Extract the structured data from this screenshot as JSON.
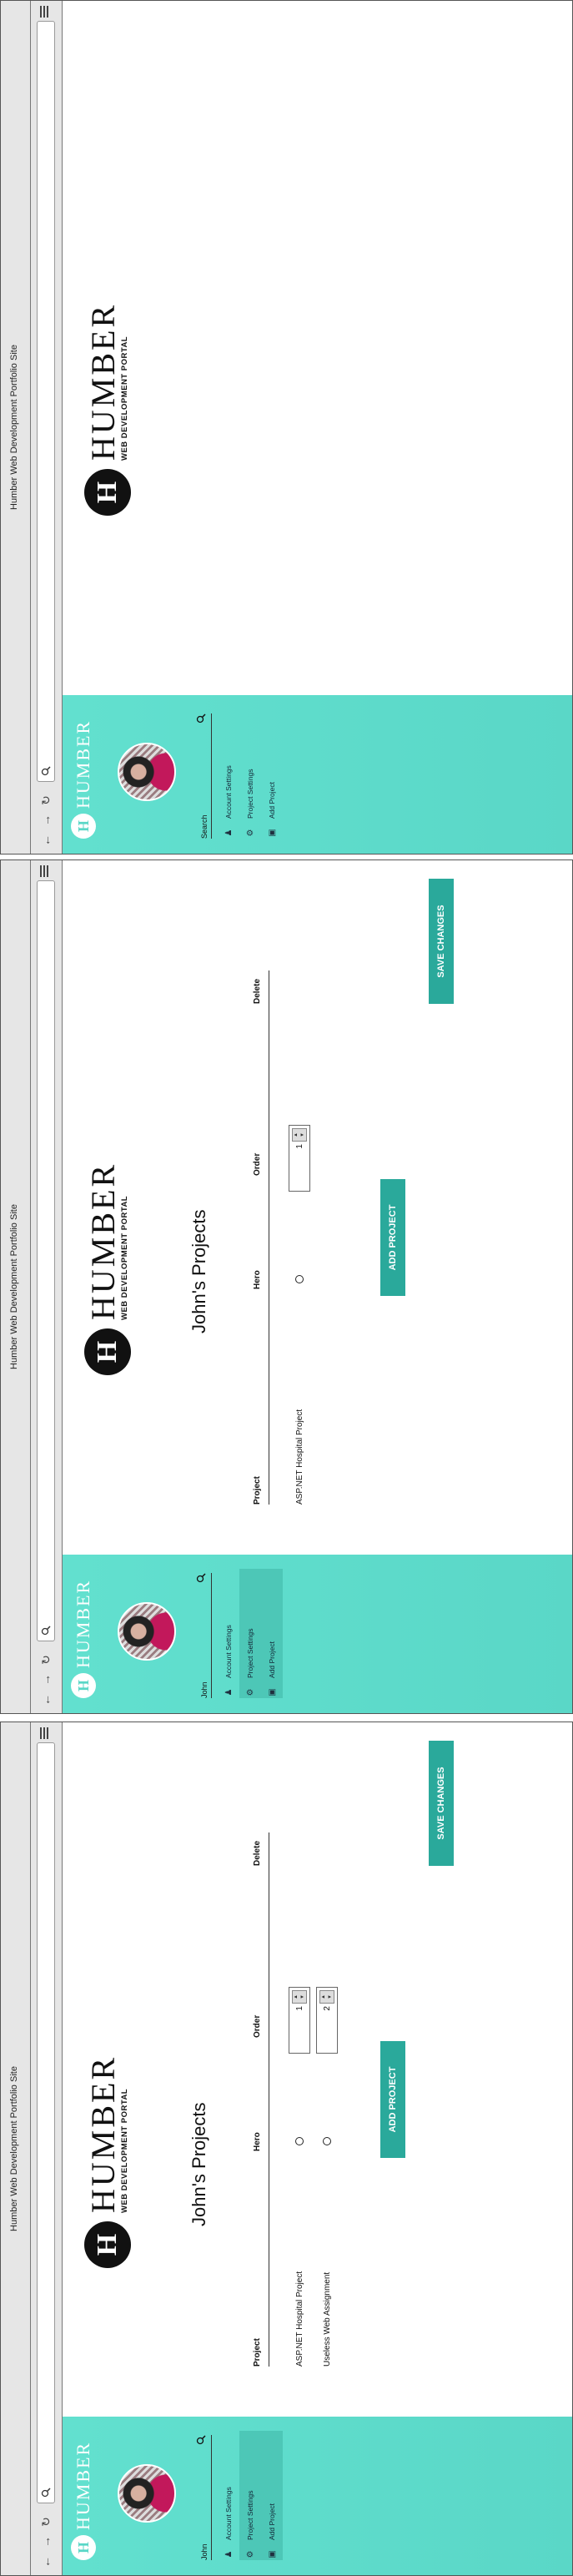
{
  "browser": {
    "window_title": "Humber Web Development Portfolio Site",
    "icons": [
      "back-arrow-icon",
      "forward-arrow-icon",
      "refresh-icon",
      "search-icon",
      "hamburger-menu-icon"
    ]
  },
  "sidebar": {
    "brand": "HUMBER",
    "brand_mark": "H",
    "search_label": "Search",
    "user_name": "John",
    "items": [
      {
        "label": "Account Settings",
        "icon": "users-icon"
      },
      {
        "label": "Project Settings",
        "icon": "gear-icon"
      },
      {
        "label": "Add Project",
        "icon": "upload-icon"
      }
    ],
    "colors": {
      "background": "#5ad7c7",
      "active": "#4dc7b7"
    }
  },
  "main": {
    "logo_word": "HUMBER",
    "logo_sub": "WEB DEVELOPMENT PORTAL",
    "logo_mark": "H",
    "page_title": "John's Projects",
    "columns": [
      "Project",
      "Hero",
      "Order",
      "Delete"
    ],
    "rows_frame2": [
      {
        "name": "ASP.NET Hospital Project",
        "order": "1"
      }
    ],
    "rows_frame3": [
      {
        "name": "ASP.NET Hospital Project",
        "order": "1"
      },
      {
        "name": "Useless Web Assignment",
        "order": "2"
      }
    ],
    "add_button": "ADD PROJECT",
    "save_button": "SAVE CHANGES",
    "accent_color": "#2aa99b"
  }
}
